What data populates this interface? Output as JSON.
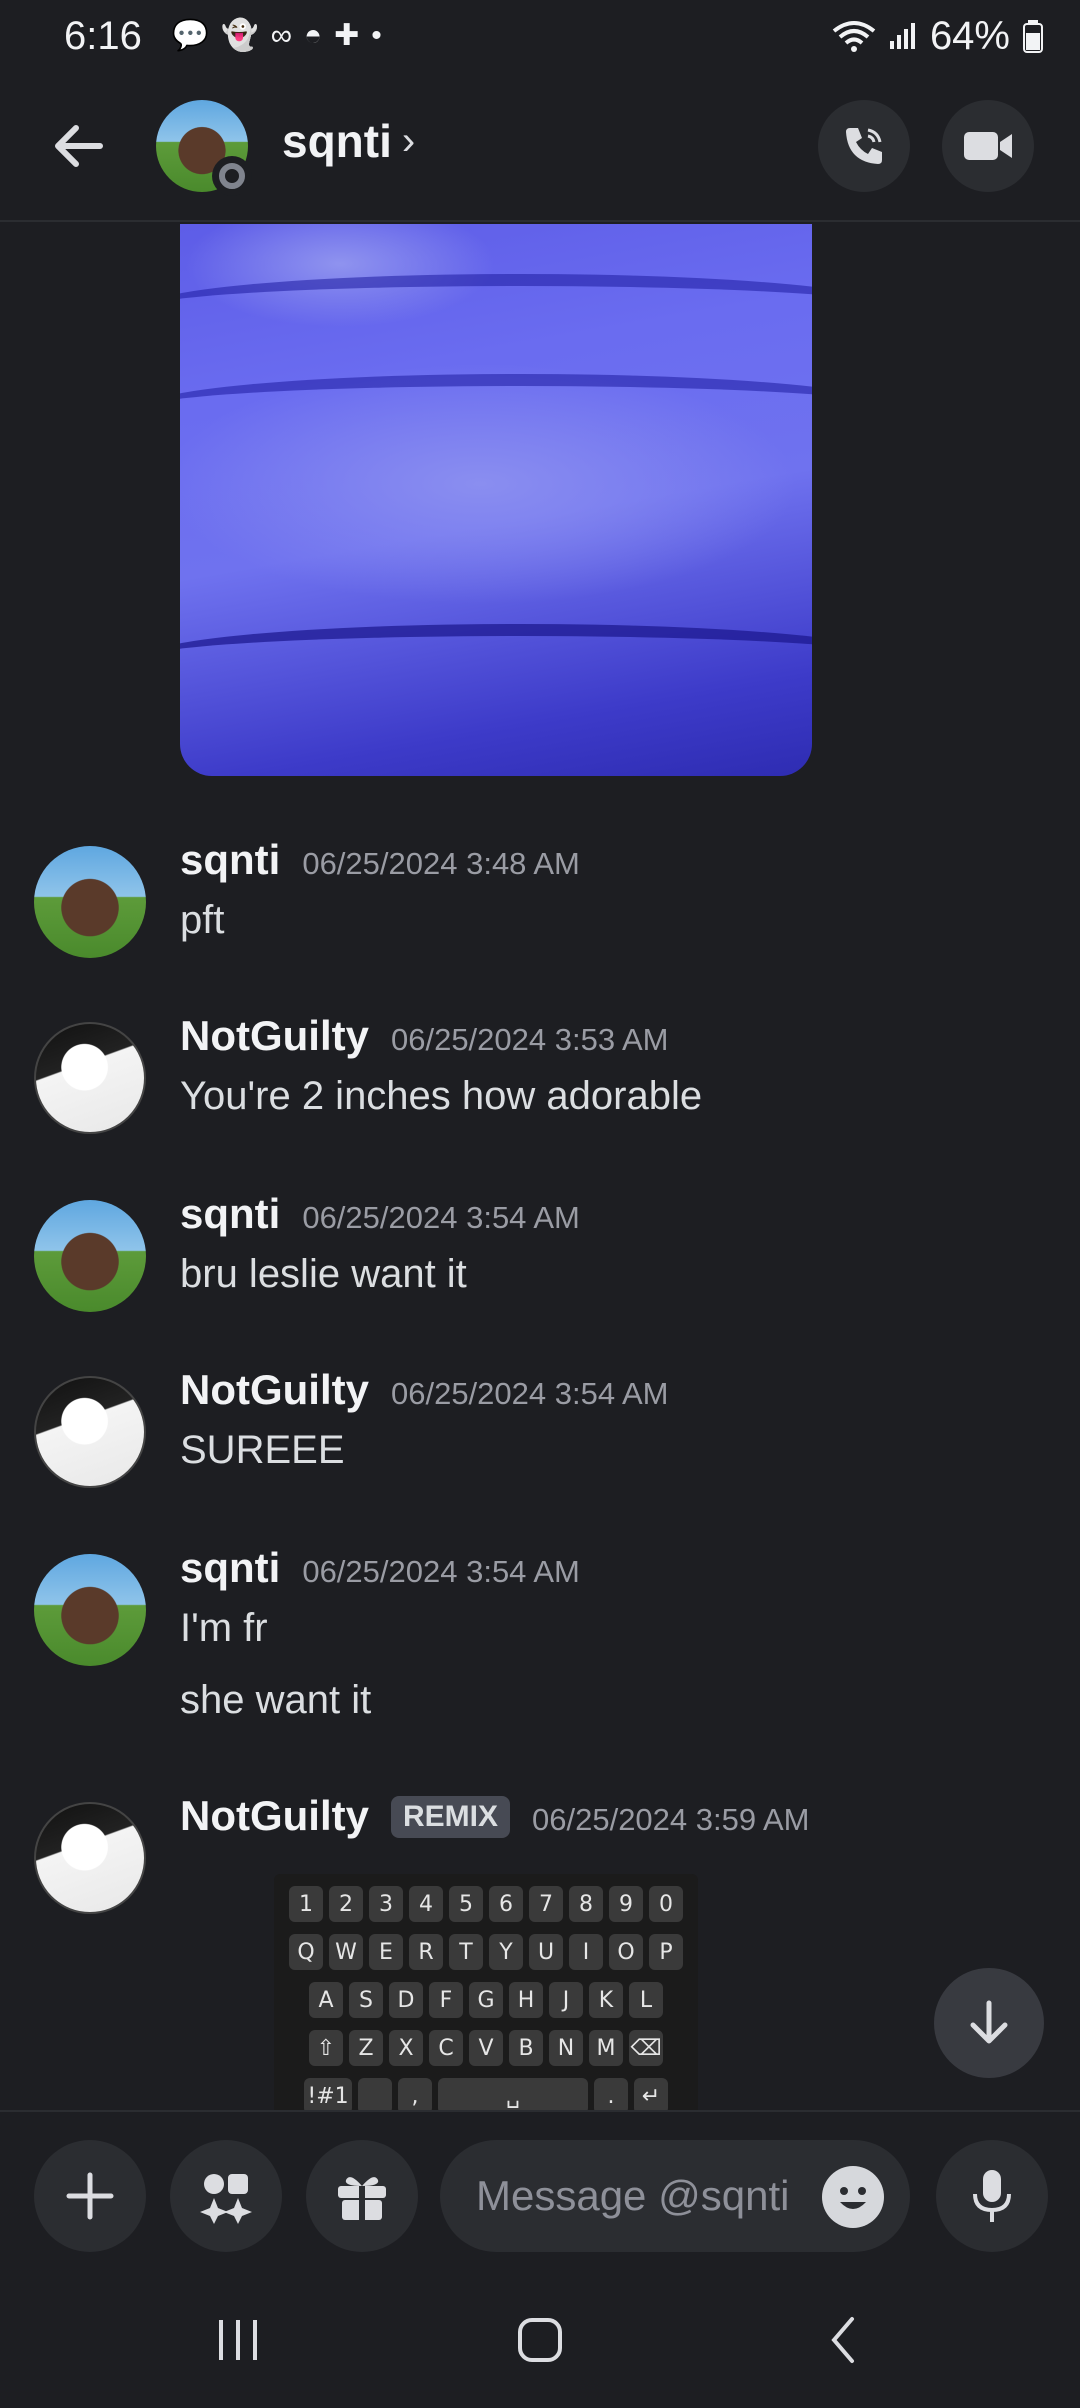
{
  "status_bar": {
    "time": "6:16",
    "battery": "64%",
    "notification_icons": [
      "chat-bubble",
      "snapchat-ghost",
      "voicemail",
      "robot",
      "medical-kit",
      "dot"
    ]
  },
  "header": {
    "contact_name": "sqnti",
    "chevron": "›"
  },
  "messages": [
    {
      "author": "sqnti",
      "timestamp": "06/25/2024 3:48 AM",
      "lines": [
        "pft"
      ]
    },
    {
      "author": "NotGuilty",
      "timestamp": "06/25/2024 3:53 AM",
      "lines": [
        "You're 2 inches how adorable"
      ]
    },
    {
      "author": "sqnti",
      "timestamp": "06/25/2024 3:54 AM",
      "lines": [
        "bru leslie want it"
      ]
    },
    {
      "author": "NotGuilty",
      "timestamp": "06/25/2024 3:54 AM",
      "lines": [
        "SUREEE"
      ]
    },
    {
      "author": "sqnti",
      "timestamp": "06/25/2024 3:54 AM",
      "lines": [
        "I'm fr",
        "she want it"
      ]
    },
    {
      "author": "NotGuilty",
      "tag": "REMIX",
      "timestamp": "06/25/2024 3:59 AM"
    }
  ],
  "keyboard_image": {
    "row1": [
      "1",
      "2",
      "3",
      "4",
      "5",
      "6",
      "7",
      "8",
      "9",
      "0"
    ],
    "row2": [
      "Q",
      "W",
      "E",
      "R",
      "T",
      "Y",
      "U",
      "I",
      "O",
      "P"
    ],
    "row3": [
      "A",
      "S",
      "D",
      "F",
      "G",
      "H",
      "J",
      "K",
      "L"
    ],
    "row4": [
      "⇧",
      "Z",
      "X",
      "C",
      "V",
      "B",
      "N",
      "M",
      "⌫"
    ],
    "row5": [
      "!#1",
      "",
      ",",
      "␣",
      ".",
      "↵"
    ]
  },
  "composer": {
    "placeholder": "Message @sqnti"
  },
  "colors": {
    "background": "#1d1e22",
    "button_bg": "#2b2d31",
    "timestamp": "#9a9ca4"
  }
}
